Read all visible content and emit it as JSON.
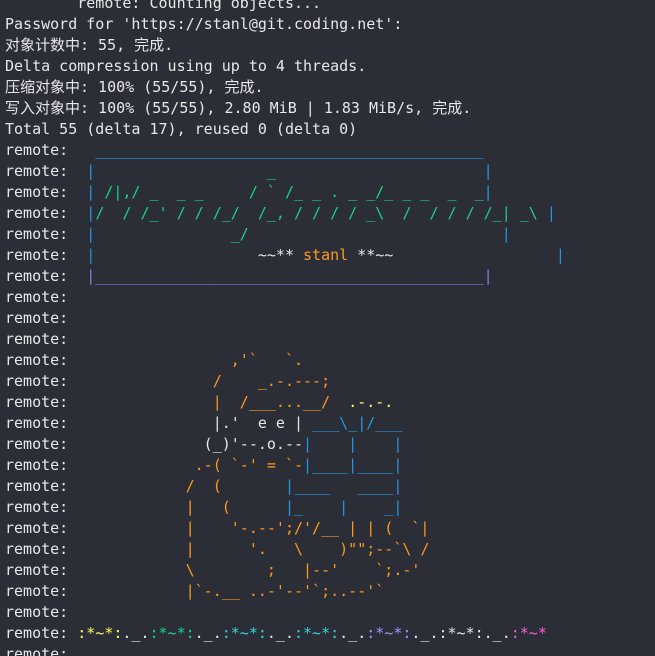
{
  "terminal": {
    "colors": {
      "background": "#2b2e37",
      "text": "#e7e7e7",
      "banner_green": "#19d18b",
      "banner_blue": "#2596e6",
      "banner_purple": "#7b82da",
      "orange": "#ff9a1a",
      "yellow": "#fffb5e",
      "cyan": "#33d6d6",
      "pink": "#ff5cd2",
      "lavender": "#a98cff"
    },
    "lines": [
      {
        "segments": [
          {
            "text": "        remote: Counting objects...",
            "color": "#e7e7e7"
          }
        ]
      },
      {
        "segments": [
          {
            "text": "Password for 'https://stanl@git.coding.net':",
            "color": "#e7e7e7"
          }
        ]
      },
      {
        "segments": [
          {
            "text": "对象计数中: 55, 完成.",
            "color": "#e7e7e7"
          }
        ]
      },
      {
        "segments": [
          {
            "text": "Delta compression using up to 4 threads.",
            "color": "#e7e7e7"
          }
        ]
      },
      {
        "segments": [
          {
            "text": "压缩对象中: 100% (55/55), 完成.",
            "color": "#e7e7e7"
          }
        ]
      },
      {
        "segments": [
          {
            "text": "写入对象中: 100% (55/55), 2.80 MiB | 1.83 MiB/s, 完成.",
            "color": "#e7e7e7"
          }
        ]
      },
      {
        "segments": [
          {
            "text": "Total 55 (delta 17), reused 0 (delta 0)",
            "color": "#e7e7e7"
          }
        ]
      },
      {
        "segments": [
          {
            "text": "remote: ",
            "color": "#e7e7e7"
          },
          {
            "text": "  ___________________________________________",
            "color": "#2596e6"
          }
        ]
      },
      {
        "segments": [
          {
            "text": "remote: ",
            "color": "#e7e7e7"
          },
          {
            "text": " |",
            "color": "#2596e6"
          },
          {
            "text": "                   _                       ",
            "color": "#19d18b"
          },
          {
            "text": "|",
            "color": "#2596e6"
          }
        ]
      },
      {
        "segments": [
          {
            "text": "remote: ",
            "color": "#e7e7e7"
          },
          {
            "text": " |",
            "color": "#2596e6"
          },
          {
            "text": " /|,/ _  _ _     / ` /_ _ . _ _/_ _ _  _  _",
            "color": "#19d18b"
          },
          {
            "text": "|",
            "color": "#2596e6"
          }
        ]
      },
      {
        "segments": [
          {
            "text": "remote: ",
            "color": "#e7e7e7"
          },
          {
            "text": " |",
            "color": "#2596e6"
          },
          {
            "text": "/  / /_' / / /_/  /_, / / / / _\\  /  / / / /_| _\\ ",
            "color": "#19d18b"
          },
          {
            "text": "|",
            "color": "#2596e6"
          }
        ]
      },
      {
        "segments": [
          {
            "text": "remote: ",
            "color": "#e7e7e7"
          },
          {
            "text": " |",
            "color": "#2596e6"
          },
          {
            "text": "               _/                            ",
            "color": "#19d18b"
          },
          {
            "text": "|",
            "color": "#2596e6"
          }
        ]
      },
      {
        "segments": [
          {
            "text": "remote: ",
            "color": "#e7e7e7"
          },
          {
            "text": " |",
            "color": "#2596e6"
          },
          {
            "text": "                  ~~** ",
            "color": "#e7e7e7"
          },
          {
            "text": "stanl",
            "color": "#ff9a1a"
          },
          {
            "text": " **~~                  ",
            "color": "#e7e7e7"
          },
          {
            "text": "|",
            "color": "#2596e6"
          }
        ]
      },
      {
        "segments": [
          {
            "text": "remote: ",
            "color": "#e7e7e7"
          },
          {
            "text": " |___________________________________________",
            "color": "#7b82da"
          },
          {
            "text": "|",
            "color": "#7b82da"
          }
        ]
      },
      {
        "segments": [
          {
            "text": "remote:",
            "color": "#e7e7e7"
          }
        ]
      },
      {
        "segments": [
          {
            "text": "remote:",
            "color": "#e7e7e7"
          }
        ]
      },
      {
        "segments": [
          {
            "text": "remote:",
            "color": "#e7e7e7"
          }
        ]
      },
      {
        "segments": [
          {
            "text": "remote: ",
            "color": "#e7e7e7"
          },
          {
            "text": "                 ,'`   `.",
            "color": "#ff9a1a"
          }
        ]
      },
      {
        "segments": [
          {
            "text": "remote: ",
            "color": "#e7e7e7"
          },
          {
            "text": "               /    _.-.---;",
            "color": "#ff9a1a"
          }
        ]
      },
      {
        "segments": [
          {
            "text": "remote: ",
            "color": "#e7e7e7"
          },
          {
            "text": "               |  /___...__/  ",
            "color": "#ff9a1a"
          },
          {
            "text": ".-.-.",
            "color": "#fffb5e"
          }
        ]
      },
      {
        "segments": [
          {
            "text": "remote: ",
            "color": "#e7e7e7"
          },
          {
            "text": "               |.'  e e | ",
            "color": "#e7e7e7"
          },
          {
            "text": "___\\_|/___",
            "color": "#2596e6"
          }
        ]
      },
      {
        "segments": [
          {
            "text": "remote: ",
            "color": "#e7e7e7"
          },
          {
            "text": "              (_)'--.o.--",
            "color": "#e7e7e7"
          },
          {
            "text": "|    |    |",
            "color": "#2596e6"
          }
        ]
      },
      {
        "segments": [
          {
            "text": "remote: ",
            "color": "#e7e7e7"
          },
          {
            "text": "             .-( `-' = `-",
            "color": "#ff9a1a"
          },
          {
            "text": "|____|____|",
            "color": "#2596e6"
          }
        ]
      },
      {
        "segments": [
          {
            "text": "remote: ",
            "color": "#e7e7e7"
          },
          {
            "text": "            /  (       ",
            "color": "#ff9a1a"
          },
          {
            "text": "|____   ____|",
            "color": "#2596e6"
          }
        ]
      },
      {
        "segments": [
          {
            "text": "remote: ",
            "color": "#e7e7e7"
          },
          {
            "text": "            |   (      ",
            "color": "#ff9a1a"
          },
          {
            "text": "|_    |    _|",
            "color": "#2596e6"
          }
        ]
      },
      {
        "segments": [
          {
            "text": "remote: ",
            "color": "#e7e7e7"
          },
          {
            "text": "            |    '-.--';/'/__ | | (  `|",
            "color": "#ff9a1a"
          }
        ]
      },
      {
        "segments": [
          {
            "text": "remote: ",
            "color": "#e7e7e7"
          },
          {
            "text": "            |      '.   \\    )\"\";--`\\ /",
            "color": "#ff9a1a"
          }
        ]
      },
      {
        "segments": [
          {
            "text": "remote: ",
            "color": "#e7e7e7"
          },
          {
            "text": "            \\        ;   |--'    `;.-'",
            "color": "#ff9a1a"
          }
        ]
      },
      {
        "segments": [
          {
            "text": "remote: ",
            "color": "#e7e7e7"
          },
          {
            "text": "            |`-.__ ..-'--'`;..--'`",
            "color": "#ff9a1a"
          }
        ]
      },
      {
        "segments": [
          {
            "text": "remote:",
            "color": "#e7e7e7"
          }
        ]
      },
      {
        "segments": [
          {
            "text": "remote: ",
            "color": "#e7e7e7"
          },
          {
            "text": ":*~*:",
            "color": "#fffb5e"
          },
          {
            "text": "._.",
            "color": "#e7e7e7"
          },
          {
            "text": ":*~*:",
            "color": "#19d18b"
          },
          {
            "text": "._.",
            "color": "#e7e7e7"
          },
          {
            "text": ":*~*:",
            "color": "#33d6d6"
          },
          {
            "text": "._.",
            "color": "#e7e7e7"
          },
          {
            "text": ":*~*:",
            "color": "#33d6d6"
          },
          {
            "text": "._.",
            "color": "#e7e7e7"
          },
          {
            "text": ":*~*:",
            "color": "#a98cff"
          },
          {
            "text": "._.",
            "color": "#e7e7e7"
          },
          {
            "text": ":*~*:",
            "color": "#e7e7e7"
          },
          {
            "text": "._.",
            "color": "#e7e7e7"
          },
          {
            "text": ":*~*",
            "color": "#ff5cd2"
          }
        ]
      },
      {
        "segments": [
          {
            "text": "remote:",
            "color": "#e7e7e7"
          }
        ]
      }
    ]
  }
}
